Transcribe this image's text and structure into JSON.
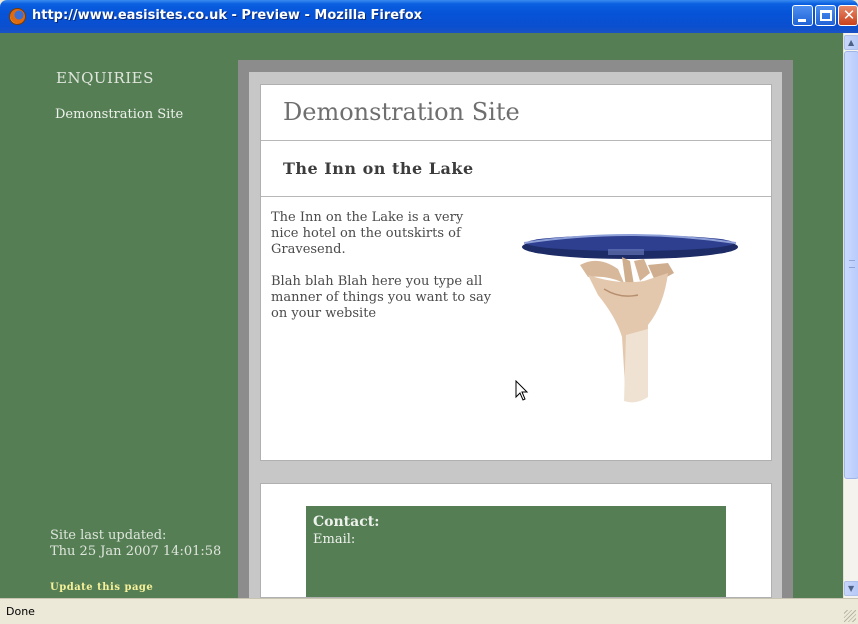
{
  "window": {
    "title": "http://www.easisites.co.uk - Preview - Mozilla Firefox",
    "close_glyph": "✕"
  },
  "sidebar": {
    "heading": "ENQUIRIES",
    "links": [
      "Demonstration Site"
    ],
    "last_updated_label": "Site last updated:",
    "last_updated_value": "Thu 25 Jan 2007 14:01:58",
    "update_link": "Update this page"
  },
  "main": {
    "site_title": "Demonstration Site",
    "page_title": "The Inn on the Lake",
    "paragraphs": [
      "The Inn on the Lake is a very nice hotel on the outskirts of Gravesend.",
      "Blah blah Blah here you type all manner of things you want to say on your website"
    ]
  },
  "contact": {
    "title": "Contact:",
    "email_label": "Email:"
  },
  "status": {
    "text": "Done"
  },
  "colors": {
    "page_green": "#567e55",
    "update_link": "#f6f19a",
    "titlebar_blue": "#0653d8"
  }
}
